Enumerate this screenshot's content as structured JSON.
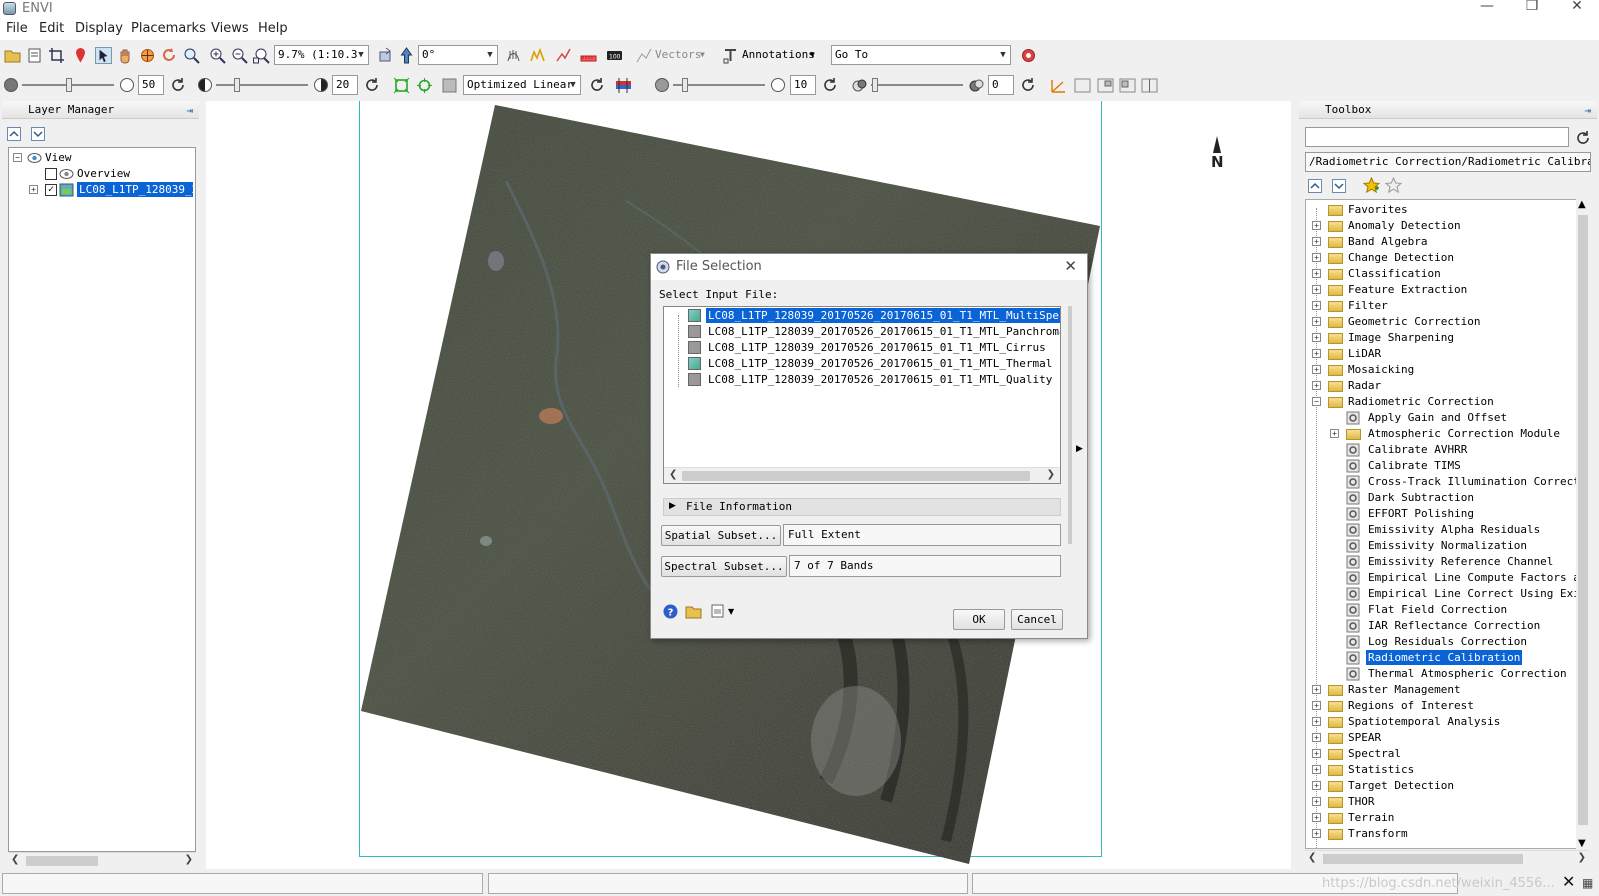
{
  "window": {
    "title": "ENVI"
  },
  "menubar": [
    "File",
    "Edit",
    "Display",
    "Placemarks",
    "Views",
    "Help"
  ],
  "toolbar": {
    "zoom_value": "9.7% (1:10.3",
    "rotation_value": "0°",
    "vectors_label": "Vectors",
    "annotations_label": "Annotations",
    "goto_value": "Go To",
    "brightness_value": "50",
    "contrast_value": "20",
    "stretch_value": "Optimized Linear",
    "sharpen_value": "10",
    "transparency_value": "0"
  },
  "layer_manager": {
    "title": "Layer Manager",
    "items": [
      {
        "label": "View"
      },
      {
        "label": "Overview"
      },
      {
        "label": "LC08_L1TP_128039_20"
      }
    ]
  },
  "map": {
    "north_label": "N"
  },
  "dialog": {
    "title": "File Selection",
    "prompt": "Select Input File:",
    "files": [
      "LC08_L1TP_128039_20170526_20170615_01_T1_MTL_MultiSpectral",
      "LC08_L1TP_128039_20170526_20170615_01_T1_MTL_Panchromatic",
      "LC08_L1TP_128039_20170526_20170615_01_T1_MTL_Cirrus",
      "LC08_L1TP_128039_20170526_20170615_01_T1_MTL_Thermal",
      "LC08_L1TP_128039_20170526_20170615_01_T1_MTL_Quality"
    ],
    "file_info_label": "File Information",
    "spatial_subset_label": "Spatial Subset...",
    "spatial_subset_value": "Full Extent",
    "spectral_subset_label": "Spectral Subset...",
    "spectral_subset_value": "7 of 7 Bands",
    "ok_label": "OK",
    "cancel_label": "Cancel"
  },
  "toolbox": {
    "title": "Toolbox",
    "search_value": "",
    "path_value": "/Radiometric Correction/Radiometric Calibration",
    "folders_top": [
      "Favorites",
      "Anomaly Detection",
      "Band Algebra",
      "Change Detection",
      "Classification",
      "Feature Extraction",
      "Filter",
      "Geometric Correction",
      "Image Sharpening",
      "LiDAR",
      "Mosaicking",
      "Radar",
      "Radiometric Correction"
    ],
    "radiometric_children": [
      "Apply Gain and Offset",
      "Atmospheric Correction Module",
      "Calibrate AVHRR",
      "Calibrate TIMS",
      "Cross-Track Illumination Correction",
      "Dark Subtraction",
      "EFFORT Polishing",
      "Emissivity Alpha Residuals",
      "Emissivity Normalization",
      "Emissivity Reference Channel",
      "Empirical Line Compute Factors and Correct",
      "Empirical Line Correct Using Existing Factors",
      "Flat Field Correction",
      "IAR Reflectance Correction",
      "Log Residuals Correction",
      "Radiometric Calibration",
      "Thermal Atmospheric Correction"
    ],
    "selected_child": "Radiometric Calibration",
    "folders_bottom": [
      "Raster Management",
      "Regions of Interest",
      "Spatiotemporal Analysis",
      "SPEAR",
      "Spectral",
      "Statistics",
      "Target Detection",
      "THOR",
      "Terrain",
      "Transform"
    ]
  },
  "statusbar": {
    "watermark": "https://blog.csdn.net/weixin_4556..."
  },
  "colors": {
    "selection": "#0a64d6",
    "view_frame": "#33bbbb",
    "folder": "#e8c85a"
  }
}
